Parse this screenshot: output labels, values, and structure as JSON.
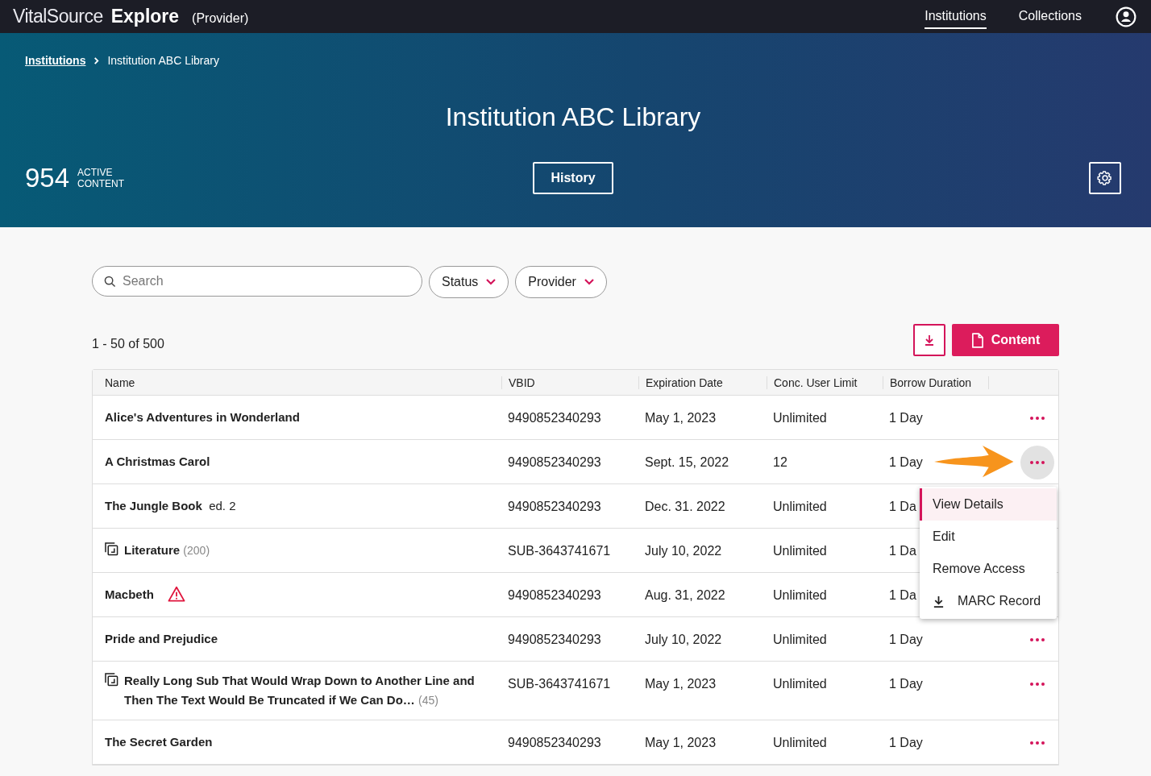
{
  "topbar": {
    "logo": "VitalSource",
    "product": "Explore",
    "role": "(Provider)",
    "nav": [
      {
        "label": "Institutions",
        "selected": true
      },
      {
        "label": "Collections",
        "selected": false
      }
    ]
  },
  "breadcrumb": {
    "link": "Institutions",
    "current": "Institution ABC Library"
  },
  "hero": {
    "title": "Institution ABC Library",
    "count": "954",
    "count_label_1": "ACTIVE",
    "count_label_2": "CONTENT",
    "history_button": "History"
  },
  "filters": {
    "search_placeholder": "Search",
    "dropdowns": [
      "Status",
      "Provider"
    ]
  },
  "results": "1 - 50 of 500",
  "content_button": "Content",
  "table": {
    "columns": [
      "Name",
      "VBID",
      "Expiration Date",
      "Conc. User Limit",
      "Borrow Duration"
    ],
    "rows": [
      {
        "kind": "title",
        "name": "Alice's Adventures in Wonderland",
        "vbid": "9490852340293",
        "expiration": "May 1, 2023",
        "limit": "Unlimited",
        "borrow": "1 Day",
        "menu_open": false
      },
      {
        "kind": "title",
        "name": "A Christmas Carol",
        "vbid": "9490852340293",
        "expiration": "Sept. 15, 2022",
        "limit": "12",
        "borrow": "1 Day",
        "menu_open": true
      },
      {
        "kind": "edition",
        "name": "The Jungle Book",
        "edition": "ed. 2",
        "vbid": "9490852340293",
        "expiration": "Dec. 31. 2022",
        "limit": "Unlimited",
        "borrow": "1 Da",
        "menu_open": false
      },
      {
        "kind": "collection",
        "name": "Literature",
        "count": "(200)",
        "vbid": "SUB-3643741671",
        "expiration": "July 10, 2022",
        "limit": "Unlimited",
        "borrow": "1 Da",
        "menu_open": false
      },
      {
        "kind": "warning",
        "name": "Macbeth",
        "vbid": "9490852340293",
        "expiration": "Aug. 31, 2022",
        "limit": "Unlimited",
        "borrow": "1 Da",
        "menu_open": false
      },
      {
        "kind": "title",
        "name": "Pride and Prejudice",
        "vbid": "9490852340293",
        "expiration": "July 10, 2022",
        "limit": "Unlimited",
        "borrow": "1 Day",
        "menu_open": false
      },
      {
        "kind": "collection",
        "name": "Really Long Sub That Would Wrap Down to Another Line and Then The Text Would Be Truncated if We Can Do…",
        "count": "(45)",
        "vbid": "SUB-3643741671",
        "expiration": "May 1, 2023",
        "limit": "Unlimited",
        "borrow": "1 Day",
        "menu_open": false
      },
      {
        "kind": "title",
        "name": "The Secret Garden",
        "vbid": "9490852340293",
        "expiration": "May 1, 2023",
        "limit": "Unlimited",
        "borrow": "1 Day",
        "menu_open": false
      }
    ]
  },
  "row_menu": [
    {
      "label": "View Details",
      "selected": true,
      "kind": "text"
    },
    {
      "label": "Edit",
      "selected": false,
      "kind": "text"
    },
    {
      "label": "Remove Access",
      "selected": false,
      "kind": "text"
    },
    {
      "label": "MARC Record",
      "selected": false,
      "kind": "download"
    }
  ]
}
